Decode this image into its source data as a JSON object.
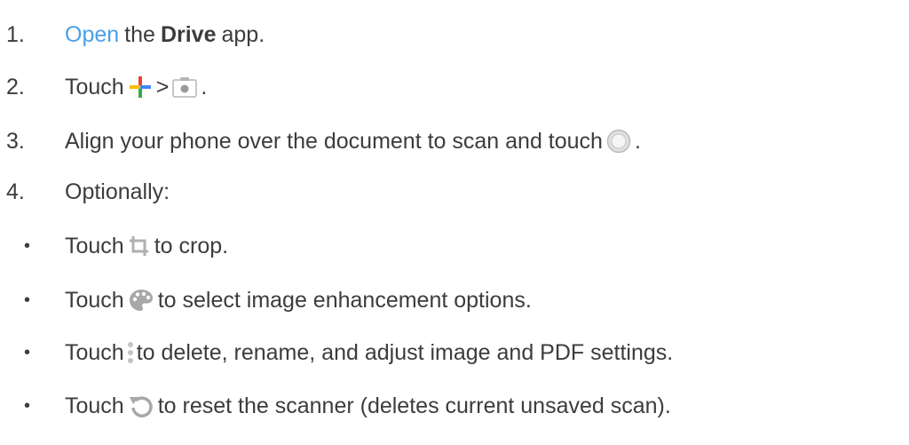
{
  "steps": [
    {
      "num": "1.",
      "link": "Open",
      "pre": "the",
      "bold": "Drive",
      "post": "app."
    },
    {
      "num": "2.",
      "pre": "Touch",
      "sep": ">",
      "post": "."
    },
    {
      "num": "3.",
      "pre": "Align your phone over the document to scan and touch",
      "post": "."
    },
    {
      "num": "4.",
      "text": "Optionally:"
    }
  ],
  "bullets": [
    {
      "mark": "•",
      "pre": "Touch",
      "post": "to crop."
    },
    {
      "mark": "•",
      "pre": "Touch",
      "post": "to select image enhancement options."
    },
    {
      "mark": "•",
      "pre": "Touch",
      "post": "to delete, rename, and adjust image and PDF settings."
    },
    {
      "mark": "•",
      "pre": "Touch",
      "post": "to reset the scanner (deletes current unsaved scan)."
    }
  ],
  "icons": {
    "add": "google-plus-icon",
    "camera": "camera-icon",
    "shutter": "shutter-icon",
    "crop": "crop-icon",
    "palette": "palette-icon",
    "more": "more-vertical-icon",
    "reset": "reset-icon"
  },
  "colors": {
    "text": "#3c3c3c",
    "link": "#4a9fe8"
  }
}
